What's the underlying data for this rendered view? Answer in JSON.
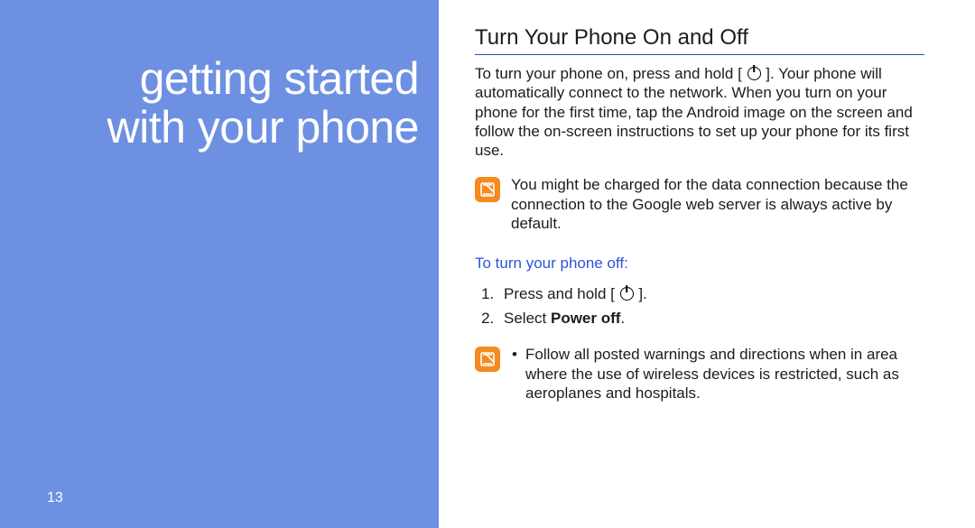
{
  "left": {
    "title_line1": "getting started",
    "title_line2": "with your phone",
    "page_number": "13"
  },
  "right": {
    "section_title": "Turn Your Phone On and Off",
    "intro_part1": "To turn your phone on, press and hold [",
    "intro_part2": "]. Your phone will automatically connect to the network. When you turn on your phone for the first time, tap the Android image on the screen and follow the on-screen instructions to set up your phone for its first use.",
    "note1": "You might be charged for the data connection because the connection to the Google web server is always active by default.",
    "sub_heading": "To turn your phone off:",
    "step1_part1": "Press and hold [",
    "step1_part2": "].",
    "step2_prefix": "Select ",
    "step2_bold": "Power off",
    "step2_suffix": ".",
    "note2": "Follow all posted warnings and directions when in area where the use of wireless devices is restricted, such as aeroplanes and hospitals.",
    "bullet": "•"
  }
}
